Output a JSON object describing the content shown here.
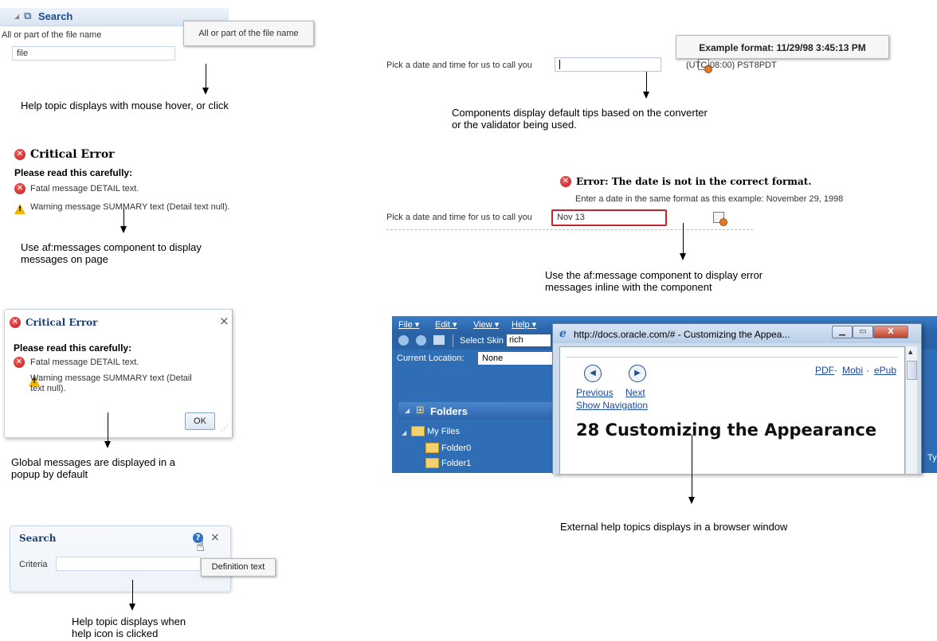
{
  "panel1": {
    "header_title": "Search",
    "field_label": "All or part of the file name",
    "field_value": "file",
    "tooltip": "All or part of the file name",
    "caption": "Help topic displays with mouse hover, or click"
  },
  "panel2": {
    "title": "Critical Error",
    "subtitle": "Please read this carefully:",
    "msg1": "Fatal message DETAIL text.",
    "msg2": "Warning message SUMMARY text (Detail text null).",
    "caption1": "Use af:messages component to display",
    "caption2": "messages on page"
  },
  "panel3": {
    "title": "Critical Error",
    "close": "×",
    "subtitle": "Please read this carefully:",
    "msg1": "Fatal message DETAIL text.",
    "msg2a": "Warning message SUMMARY text (Detail",
    "msg2b": "text null).",
    "ok": "OK",
    "caption1": "Global messages are displayed in a",
    "caption2": "popup by default"
  },
  "panel4": {
    "title": "Search",
    "close": "×",
    "criteria": "Criteria",
    "tooltip": "Definition text",
    "caption1": "Help topic displays when",
    "caption2": "help icon is clicked"
  },
  "panel5": {
    "tooltip": "Example format: 11/29/98 3:45:13 PM",
    "label": "Pick a date and time for us to call you",
    "timezone": "(UTC-08:00) PST8PDT",
    "caption1": "Components display default tips based on the converter",
    "caption2": "or the validator being used."
  },
  "panel6": {
    "error_title": "Error: The date is not in the correct format.",
    "error_detail": "Enter a date in the same format as this example: November 29, 1998",
    "label": "Pick a date and time for us to call you",
    "field_value": "Nov 13",
    "caption1": "Use the af:message component to display error",
    "caption2": "messages inline with the component"
  },
  "panel7": {
    "menu": [
      "File ▾",
      "Edit ▾",
      "View ▾",
      "Help ▾"
    ],
    "select_skin": "Select Skin",
    "skin_value": "rich",
    "current_location_label": "Current Location:",
    "current_location_value": "None",
    "folders_title": "Folders",
    "tree": [
      "My Files",
      "Folder0",
      "Folder1"
    ],
    "browser_title": "http://docs.oracle.com/# - Customizing the Appea...",
    "pdf": "PDF",
    "mobi": "Mobi",
    "epub": "ePub",
    "separator": "·",
    "previous": "Previous",
    "next": "Next",
    "show_navigation": "Show Navigation",
    "heading": "28 Customizing the Appearance",
    "right_edge_fragment": "Ty",
    "caption": "External help topics displays in a browser window"
  },
  "colors": {
    "header_blue": "#dfe9f5",
    "error_red": "#c41a1a",
    "warning_yellow": "#f2b705",
    "app_blue": "#2f6db5",
    "link_blue": "#1a4aa5"
  }
}
